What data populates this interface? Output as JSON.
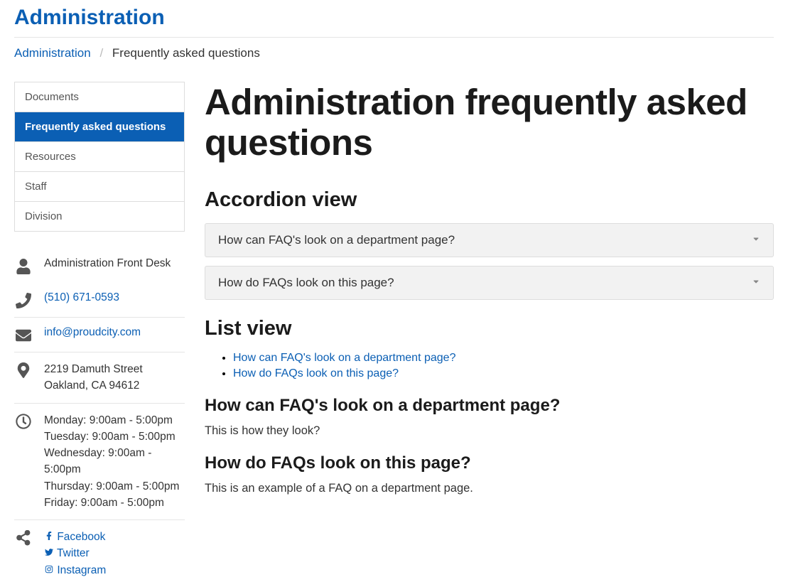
{
  "site_title": "Administration",
  "breadcrumb": {
    "root": "Administration",
    "current": "Frequently asked questions"
  },
  "sidebar": {
    "nav": [
      {
        "label": "Documents",
        "active": false
      },
      {
        "label": "Frequently asked questions",
        "active": true
      },
      {
        "label": "Resources",
        "active": false
      },
      {
        "label": "Staff",
        "active": false
      },
      {
        "label": "Division",
        "active": false
      }
    ],
    "contact_name": "Administration Front Desk",
    "phone": "(510) 671-0593",
    "email": "info@proudcity.com",
    "address_line1": "2219 Damuth Street",
    "address_line2": "Oakland, CA 94612",
    "hours": [
      "Monday: 9:00am - 5:00pm",
      "Tuesday: 9:00am - 5:00pm",
      "Wednesday: 9:00am - 5:00pm",
      "Thursday: 9:00am - 5:00pm",
      "Friday: 9:00am - 5:00pm"
    ],
    "social": {
      "facebook": "Facebook",
      "twitter": "Twitter",
      "instagram": "Instagram"
    }
  },
  "main": {
    "title": "Administration frequently asked questions",
    "accordion_heading": "Accordion view",
    "accordion": [
      "How can FAQ's look on a department page?",
      "How do FAQs look on this page?"
    ],
    "list_heading": "List view",
    "list": [
      "How can FAQ's look on a department page?",
      "How do FAQs look on this page?"
    ],
    "faq1_title": "How can FAQ's look on a department page?",
    "faq1_body": "This is how they look?",
    "faq2_title": "How do FAQs look on this page?",
    "faq2_body": "This is an example of a FAQ on a department page."
  }
}
